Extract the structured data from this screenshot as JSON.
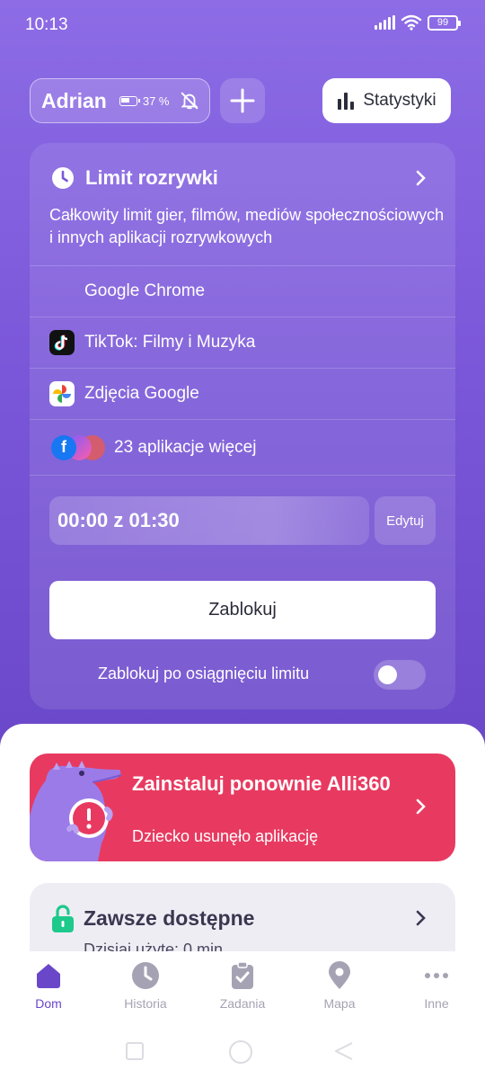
{
  "status_bar": {
    "time": "10:13",
    "battery": "99"
  },
  "header": {
    "profile_name": "Adrian",
    "device_battery": "37 %",
    "stats_label": "Statystyki"
  },
  "limit_card": {
    "title": "Limit rozrywki",
    "description": "Całkowity limit gier, filmów, mediów społecznościowych i innych aplikacji rozrywkowych",
    "apps": [
      {
        "name": "Google Chrome",
        "icon": ""
      },
      {
        "name": "TikTok: Filmy i Muzyka",
        "icon": "tiktok-icon"
      },
      {
        "name": "Zdjęcia Google",
        "icon": "google-photos-icon"
      }
    ],
    "more_apps_label": "23 aplikacje więcej",
    "time_used": "00:00 z 01:30",
    "edit_label": "Edytuj",
    "block_label": "Zablokuj",
    "auto_block_label": "Zablokuj po osiągnięciu limitu",
    "auto_block_enabled": false
  },
  "alert_card": {
    "title": "Zainstaluj ponownie Alli360",
    "subtitle": "Dziecko usunęło aplikację"
  },
  "always_card": {
    "title": "Zawsze dostępne",
    "subtitle": "Dzisiaj użyte: 0 min"
  },
  "bottom_nav": [
    {
      "label": "Dom",
      "icon": "home-icon",
      "active": true
    },
    {
      "label": "Historia",
      "icon": "clock-icon",
      "active": false
    },
    {
      "label": "Zadania",
      "icon": "clipboard-check-icon",
      "active": false
    },
    {
      "label": "Mapa",
      "icon": "map-pin-icon",
      "active": false
    },
    {
      "label": "Inne",
      "icon": "more-icon",
      "active": false
    }
  ],
  "colors": {
    "accent": "#6a47c9",
    "alert": "#e83a60",
    "nav_inactive": "#a5a3b3"
  }
}
